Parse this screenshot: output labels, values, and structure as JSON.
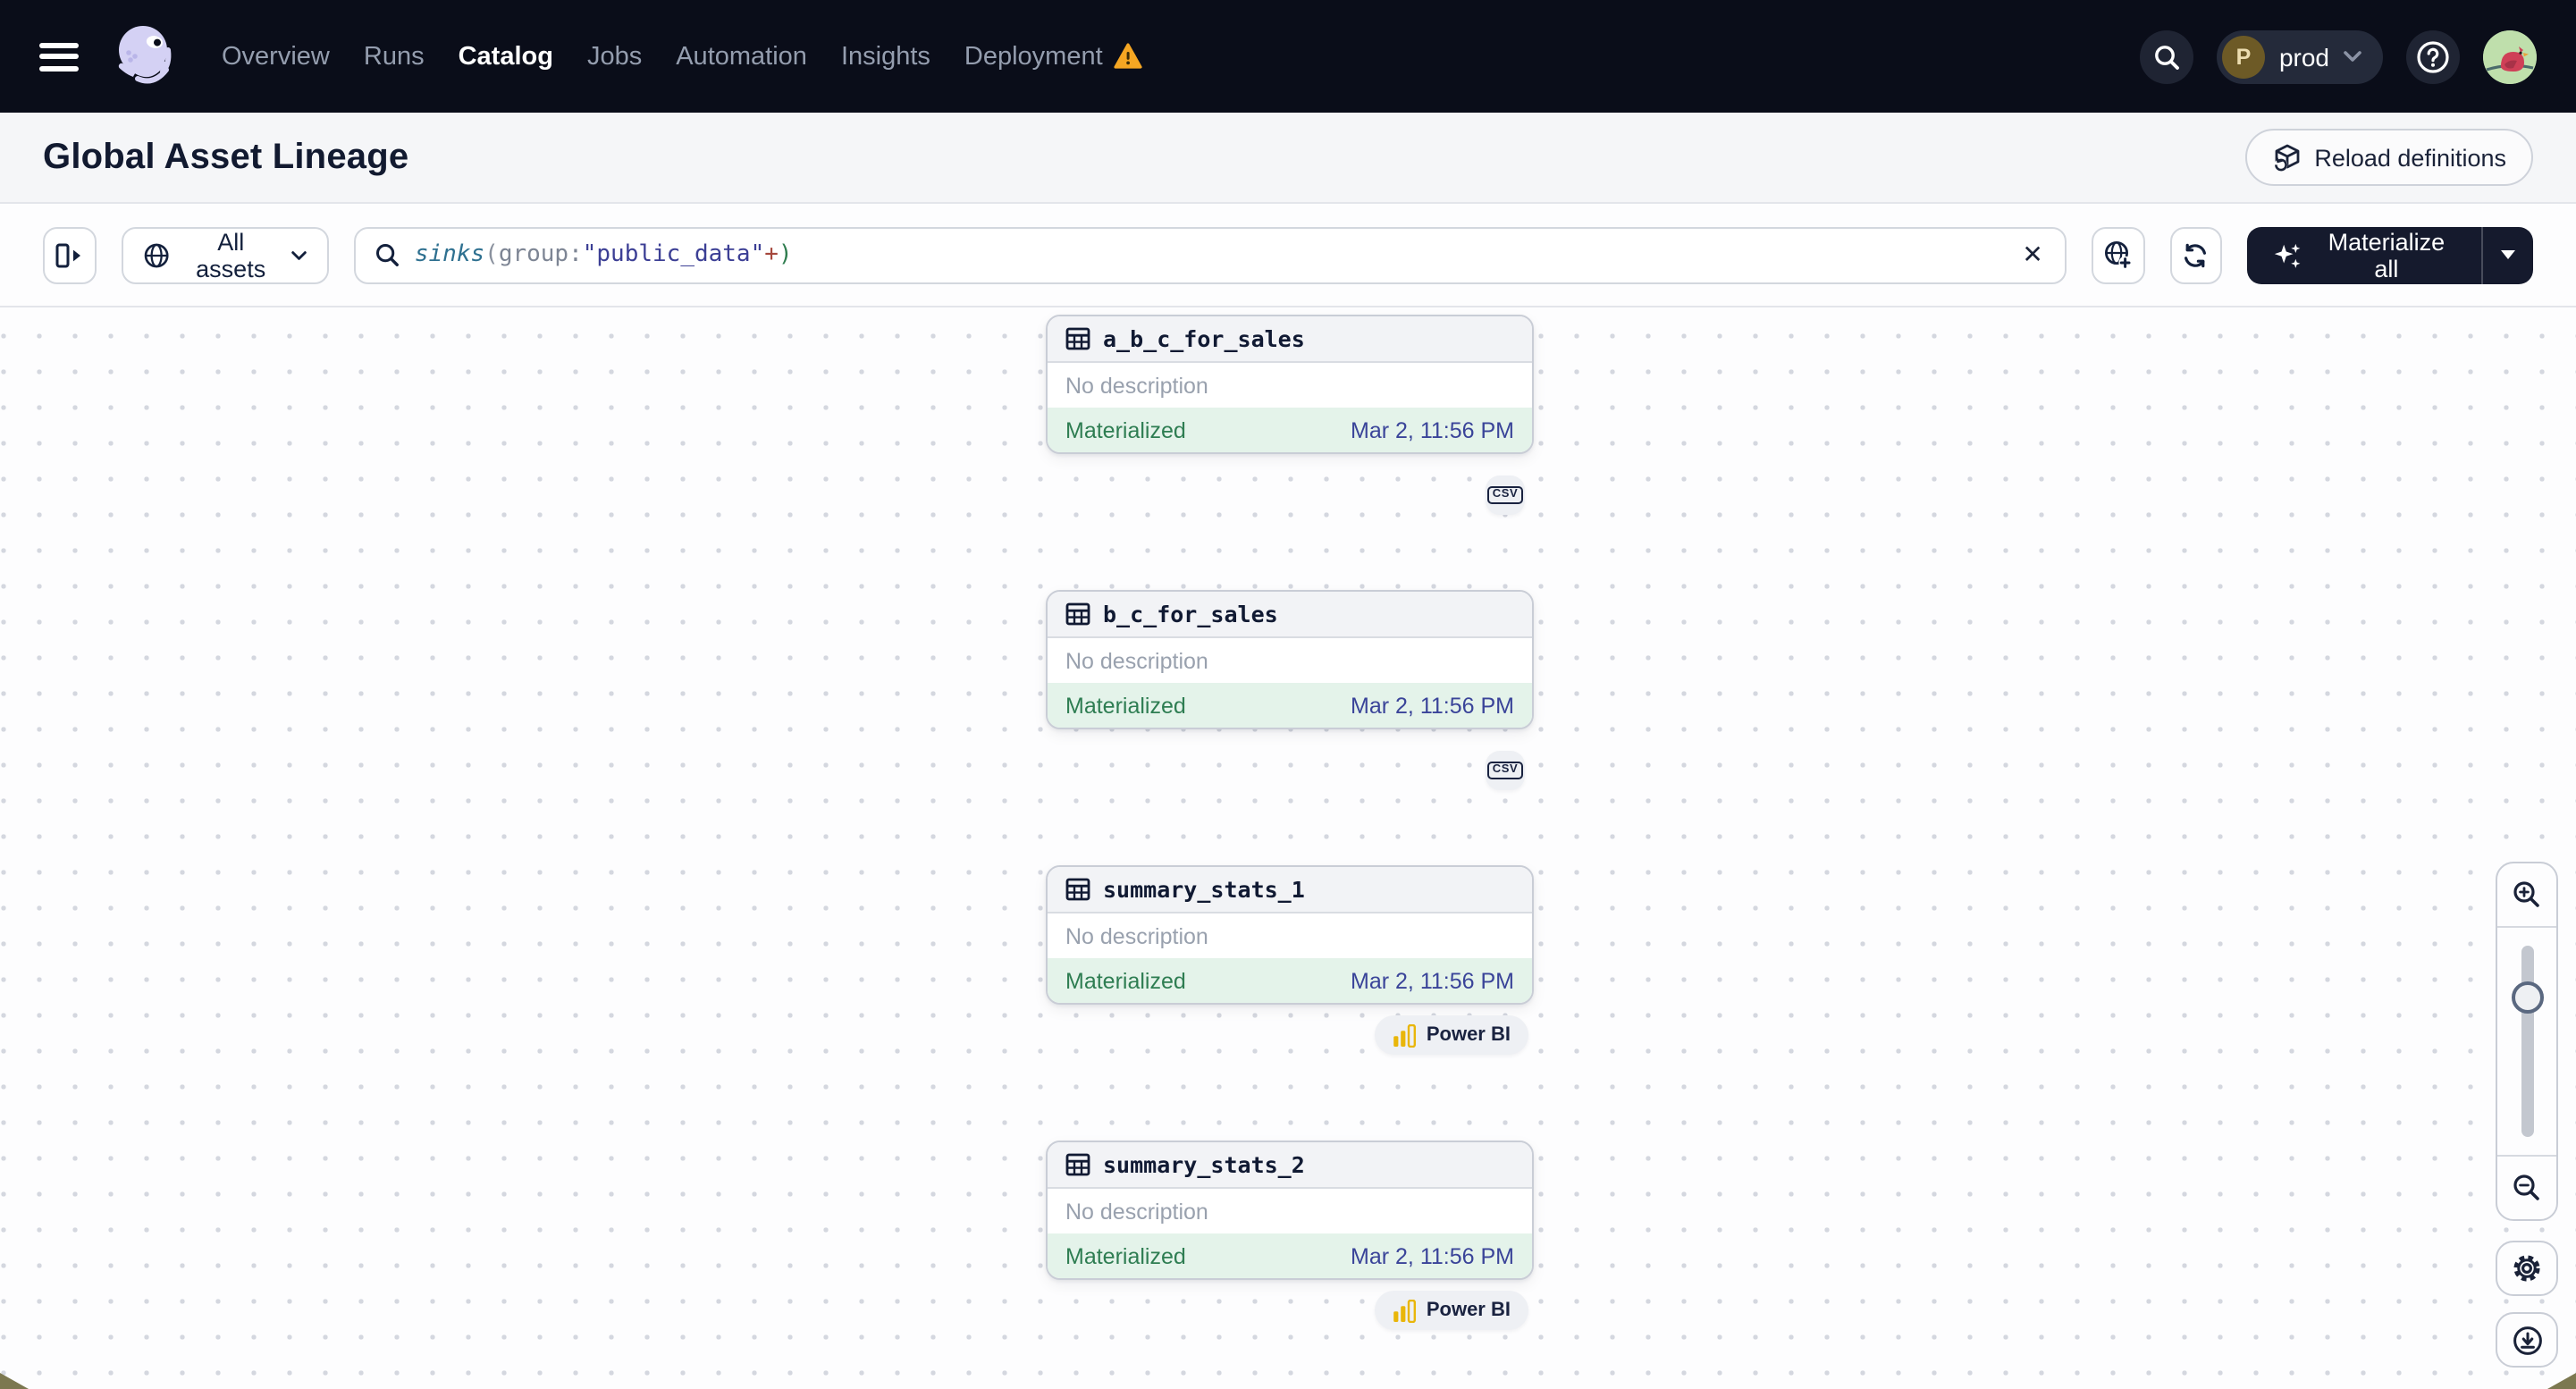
{
  "nav": {
    "items": [
      {
        "label": "Overview"
      },
      {
        "label": "Runs"
      },
      {
        "label": "Catalog"
      },
      {
        "label": "Jobs"
      },
      {
        "label": "Automation"
      },
      {
        "label": "Insights"
      },
      {
        "label": "Deployment"
      }
    ],
    "active_item": "Catalog",
    "environment": {
      "initial": "P",
      "label": "prod"
    }
  },
  "page": {
    "title": "Global Asset Lineage",
    "reload_label": "Reload definitions"
  },
  "toolbar": {
    "scope_label": "All assets",
    "query": {
      "fn": "sinks",
      "open": "(",
      "attr": "group:",
      "value": "\"public_data\"",
      "op": "+",
      "close": ")"
    },
    "clear_label": "✕",
    "materialize_label": "Materialize all"
  },
  "graph": {
    "nodes": [
      {
        "name": "a_b_c_for_sales",
        "description": "No description",
        "status": "Materialized",
        "timestamp": "Mar 2, 11:56 PM",
        "kind": "CSV"
      },
      {
        "name": "b_c_for_sales",
        "description": "No description",
        "status": "Materialized",
        "timestamp": "Mar 2, 11:56 PM",
        "kind": "CSV"
      },
      {
        "name": "summary_stats_1",
        "description": "No description",
        "status": "Materialized",
        "timestamp": "Mar 2, 11:56 PM",
        "kind": "Power BI"
      },
      {
        "name": "summary_stats_2",
        "description": "No description",
        "status": "Materialized",
        "timestamp": "Mar 2, 11:56 PM",
        "kind": "Power BI"
      }
    ]
  },
  "colors": {
    "nav_bg": "#0a0d19",
    "warning_orange": "#f5a623",
    "materialized_green": "#2e7d52",
    "timestamp_indigo": "#3a4499",
    "powerbi_yellow": "#e9b60a",
    "accent_dark": "#151a2d",
    "footer_green_bg": "#e4f3ea"
  }
}
